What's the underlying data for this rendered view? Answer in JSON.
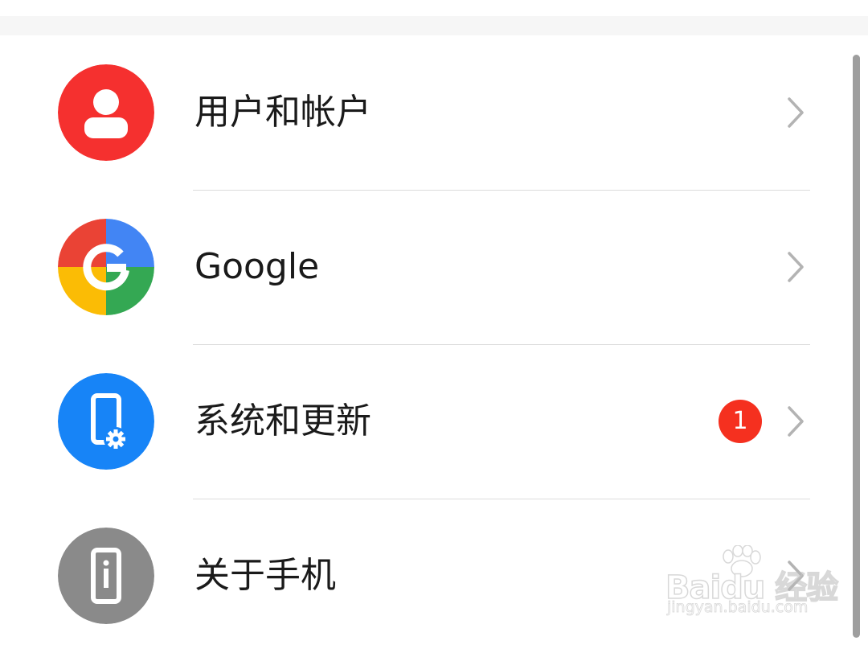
{
  "settings_list": {
    "items": [
      {
        "label": "用户和帐户",
        "icon": "user-account-icon",
        "icon_color": "#f5302f"
      },
      {
        "label": "Google",
        "icon": "google-logo-icon",
        "icon_color": "#4285f4"
      },
      {
        "label": "系统和更新",
        "icon": "phone-settings-icon",
        "icon_color": "#1784f7",
        "badge": "1",
        "badge_color": "#f5301f"
      },
      {
        "label": "关于手机",
        "icon": "phone-info-icon",
        "icon_color": "#8a8a8a"
      }
    ]
  },
  "watermark": {
    "brand": "Baidu 经验",
    "url": "jingyan.baidu.com"
  }
}
